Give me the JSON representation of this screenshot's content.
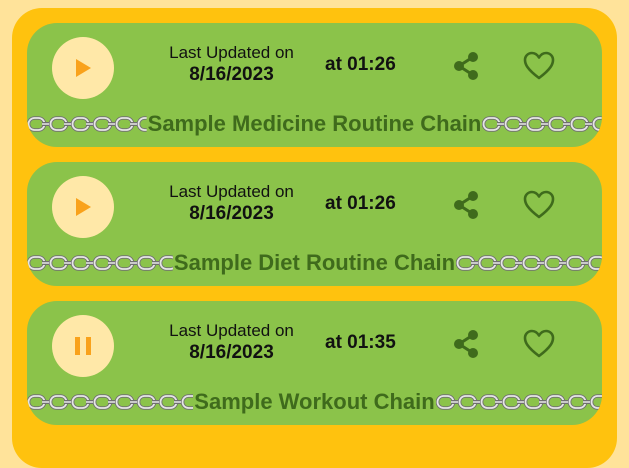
{
  "colors": {
    "background": "#FFE39A",
    "panel": "#FFC20E",
    "card": "#8BC34A",
    "play_button_bg": "#FFE8A8",
    "play_icon": "#F9A21B",
    "icon_dark_green": "#3F6B1C",
    "chain_title": "#3F6B1C"
  },
  "routines": [
    {
      "title": "Sample Medicine Routine Chain",
      "updated_label": "Last Updated on",
      "date": "8/16/2023",
      "time": "at 01:26",
      "play_state": "play",
      "play_icon": "play-icon"
    },
    {
      "title": "Sample Diet Routine Chain",
      "updated_label": "Last Updated on",
      "date": "8/16/2023",
      "time": "at 01:26",
      "play_state": "play",
      "play_icon": "play-icon"
    },
    {
      "title": "Sample Workout Chain",
      "updated_label": "Last Updated on",
      "date": "8/16/2023",
      "time": "at 01:35",
      "play_state": "pause",
      "play_icon": "pause-icon"
    }
  ]
}
